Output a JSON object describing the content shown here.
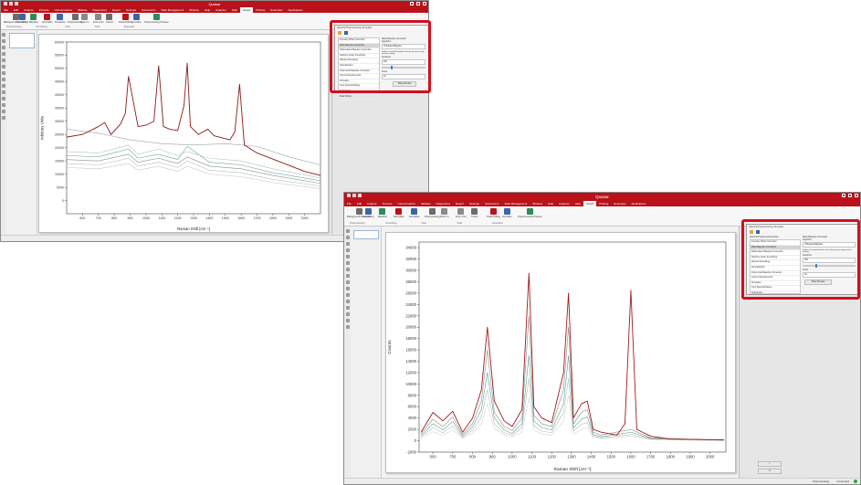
{
  "windows": {
    "top": {
      "title": "Quasar",
      "menus": [
        "File",
        "Edit",
        "Analyze",
        "Process",
        "Chemometrics",
        "Validate",
        "Diagnostics",
        "Report",
        "Settings",
        "Instruments",
        "Data Management",
        "Window",
        "Help",
        "Analyzer",
        "Help",
        "Graph",
        "Plotting",
        "Examples",
        "Applications"
      ],
      "active_menu": "Graph"
    },
    "bottom": {
      "title": "Quasar",
      "menus": [
        "File",
        "Edit",
        "Analyze",
        "Process",
        "Chemometrics",
        "Validate",
        "Diagnostics",
        "Report",
        "Settings",
        "Instruments",
        "Data Management",
        "Window",
        "Help",
        "Analyzer",
        "Help",
        "Graph",
        "Plotting",
        "Examples",
        "Applications"
      ],
      "active_menu": "Graph"
    }
  },
  "ribbon": {
    "buttons": [
      "Background Correction",
      "Smoothing",
      "Baseline",
      "Normalize",
      "Derivative",
      "Preprocessing",
      "Zoom In",
      "Zoom Out",
      "Cursor",
      "Peak Picking",
      "Annotate",
      "Preprocessing Preview"
    ],
    "groups": [
      "Preprocessing",
      "Smoothing",
      "View",
      "Tools",
      "Examples"
    ]
  },
  "dialog": {
    "title": "Spectral Preprocessing Template",
    "steps_header": "Spectral Preprocessing Steps",
    "steps": [
      "Intensity Offset Correction",
      "Rank Baseline Correction",
      "Rubberband Baseline Correction",
      "Savitzky-Golay Smoothing",
      "Wavelet Denoising",
      "Normalization",
      "Polynomial Baseline Correction",
      "Cosmic Ray Removal",
      "Derivative",
      "Crop Spectral Range",
      "Subtraction",
      "Peak Fitting"
    ],
    "selected_index": 1,
    "params_header": "Rank Baseline Correction",
    "algorithm_label": "Algorithm",
    "algorithm_value": "IT-Ranked Baseline",
    "description": "Subtract a smooth baseline from the spectrum using iterative ranking",
    "iterations_label": "Iterations",
    "iterations_value": "100",
    "knots_label": "Knots",
    "knots_value": "24",
    "preview_button": "Show Preview"
  },
  "status": {
    "label": "Preprocessing",
    "state": "Connected"
  },
  "chart_data": [
    {
      "type": "line",
      "title": "",
      "xlabel": "Raman Shift [cm⁻¹]",
      "ylabel": "Arbitrary Units",
      "xlim": [
        500,
        2100
      ],
      "ylim": [
        -5000,
        60000
      ],
      "x_ticks": [
        600,
        700,
        800,
        900,
        1000,
        1100,
        1200,
        1300,
        1400,
        1500,
        1600,
        1700,
        1800,
        1900,
        2000
      ],
      "y_ticks": [
        0,
        5000,
        10000,
        15000,
        20000,
        25000,
        30000,
        35000,
        40000,
        45000,
        50000,
        55000,
        60000
      ],
      "grid": false,
      "series": [
        {
          "color": "#8b1a1a",
          "x": [
            500,
            600,
            700,
            740,
            780,
            840,
            870,
            890,
            950,
            1000,
            1050,
            1080,
            1110,
            1150,
            1200,
            1240,
            1260,
            1280,
            1330,
            1390,
            1430,
            1530,
            1560,
            1590,
            1620,
            1700,
            1850,
            2000,
            2100
          ],
          "y": [
            24000,
            25000,
            28000,
            29500,
            25000,
            29000,
            33000,
            47000,
            28000,
            28500,
            30000,
            51000,
            28000,
            27000,
            26500,
            36000,
            52000,
            28000,
            25000,
            27000,
            24500,
            23000,
            26000,
            44000,
            21000,
            18000,
            14500,
            11000,
            9500
          ]
        },
        {
          "color": "#9aa3a8",
          "x": [
            500,
            700,
            900,
            1100,
            1300,
            1500,
            1700,
            1900,
            2100
          ],
          "y": [
            27000,
            25500,
            23000,
            21500,
            21000,
            21500,
            20500,
            16500,
            13500
          ]
        },
        {
          "color": "#bdbdbd",
          "x": [
            500,
            700,
            890,
            950,
            1080,
            1200,
            1260,
            1400,
            1600,
            1800,
            2100
          ],
          "y": [
            18500,
            18000,
            21000,
            17500,
            19500,
            17000,
            18500,
            16000,
            15000,
            12000,
            8500
          ]
        },
        {
          "color": "#6fa89e",
          "x": [
            500,
            700,
            890,
            950,
            1080,
            1200,
            1260,
            1400,
            1600,
            1800,
            2100
          ],
          "y": [
            17000,
            16500,
            19500,
            16000,
            17500,
            15500,
            20500,
            14500,
            13500,
            10500,
            7500
          ]
        },
        {
          "color": "#8d8d8d",
          "x": [
            500,
            700,
            890,
            950,
            1080,
            1200,
            1260,
            1400,
            1600,
            1800,
            2100
          ],
          "y": [
            15500,
            15000,
            17500,
            14500,
            16000,
            14000,
            16500,
            13000,
            12000,
            9500,
            6500
          ]
        },
        {
          "color": "#a7c4be",
          "x": [
            500,
            700,
            890,
            950,
            1080,
            1200,
            1260,
            1400,
            1600,
            1800,
            2100
          ],
          "y": [
            14000,
            13500,
            16000,
            13000,
            14500,
            12500,
            15000,
            11500,
            10500,
            8000,
            5500
          ]
        },
        {
          "color": "#c7c7c7",
          "x": [
            500,
            700,
            890,
            950,
            1080,
            1200,
            1260,
            1400,
            1600,
            1800,
            2100
          ],
          "y": [
            12500,
            12000,
            14000,
            11500,
            13000,
            11000,
            13000,
            10000,
            9000,
            6800,
            4500
          ]
        }
      ]
    },
    {
      "type": "line",
      "title": "",
      "xlabel": "Raman Shift [cm⁻¹]",
      "ylabel": "Counts",
      "xlim": [
        530,
        2080
      ],
      "ylim": [
        -2000,
        35000
      ],
      "x_ticks": [
        600,
        700,
        800,
        900,
        1000,
        1100,
        1200,
        1300,
        1400,
        1500,
        1600,
        1700,
        1800,
        1900,
        2000
      ],
      "y_ticks": [
        -2000,
        0,
        2000,
        4000,
        6000,
        8000,
        10000,
        12000,
        14000,
        16000,
        18000,
        20000,
        22000,
        24000,
        26000,
        28000,
        30000,
        32000,
        34000
      ],
      "grid": false,
      "series": [
        {
          "color": "#a01c1c",
          "x": [
            540,
            600,
            650,
            700,
            750,
            800,
            845,
            875,
            910,
            960,
            1000,
            1050,
            1085,
            1110,
            1150,
            1200,
            1260,
            1285,
            1310,
            1350,
            1380,
            1410,
            1450,
            1530,
            1570,
            1600,
            1630,
            1700,
            1800,
            2000,
            2070
          ],
          "y": [
            1500,
            5000,
            3500,
            5200,
            1500,
            4000,
            9000,
            20000,
            7000,
            3500,
            2500,
            5500,
            29500,
            6000,
            4000,
            3200,
            12000,
            26000,
            4000,
            6500,
            7000,
            2000,
            1500,
            1000,
            3000,
            26500,
            2000,
            800,
            300,
            200,
            200
          ]
        },
        {
          "color": "#8a8a8a",
          "x": [
            540,
            600,
            650,
            700,
            750,
            800,
            845,
            875,
            910,
            960,
            1000,
            1050,
            1085,
            1110,
            1150,
            1200,
            1260,
            1285,
            1310,
            1350,
            1380,
            1410,
            1450,
            1600,
            1700,
            2070
          ],
          "y": [
            1200,
            3800,
            2500,
            4200,
            1100,
            3000,
            7000,
            16000,
            5000,
            2500,
            1800,
            4000,
            22000,
            4500,
            3000,
            2500,
            9000,
            20000,
            3000,
            5000,
            5500,
            1500,
            1000,
            2000,
            500,
            100
          ]
        },
        {
          "color": "#5aa095",
          "x": [
            540,
            600,
            650,
            700,
            750,
            800,
            845,
            875,
            910,
            960,
            1000,
            1050,
            1085,
            1110,
            1150,
            1200,
            1260,
            1285,
            1310,
            1350,
            1380,
            1410,
            1450,
            1600,
            1700,
            2070
          ],
          "y": [
            900,
            3000,
            1900,
            3400,
            800,
            2400,
            5500,
            12000,
            4000,
            1900,
            1300,
            3000,
            15000,
            3500,
            2300,
            1900,
            6500,
            15000,
            2300,
            3800,
            4200,
            1100,
            700,
            1500,
            400,
            100
          ]
        },
        {
          "color": "#b9b9b9",
          "x": [
            540,
            600,
            650,
            700,
            750,
            800,
            845,
            875,
            910,
            960,
            1000,
            1050,
            1085,
            1110,
            1150,
            1200,
            1260,
            1285,
            1310,
            1350,
            1380,
            1410,
            1450,
            1600,
            1700,
            2070
          ],
          "y": [
            700,
            2300,
            1400,
            2600,
            600,
            1800,
            4200,
            9000,
            3000,
            1400,
            1000,
            2300,
            11000,
            2600,
            1700,
            1400,
            5000,
            11000,
            1700,
            2900,
            3200,
            800,
            500,
            1100,
            300,
            50
          ]
        },
        {
          "color": "#d3d3d3",
          "x": [
            540,
            600,
            650,
            700,
            750,
            800,
            845,
            875,
            910,
            960,
            1000,
            1050,
            1085,
            1110,
            1150,
            1200,
            1260,
            1285,
            1310,
            1350,
            1380,
            1410,
            1450,
            1600,
            1700,
            2070
          ],
          "y": [
            500,
            1600,
            1000,
            1900,
            400,
            1300,
            3000,
            6500,
            2200,
            1000,
            700,
            1600,
            7500,
            1900,
            1200,
            1000,
            3500,
            8000,
            1200,
            2000,
            2300,
            600,
            350,
            800,
            200,
            30
          ]
        }
      ]
    }
  ]
}
